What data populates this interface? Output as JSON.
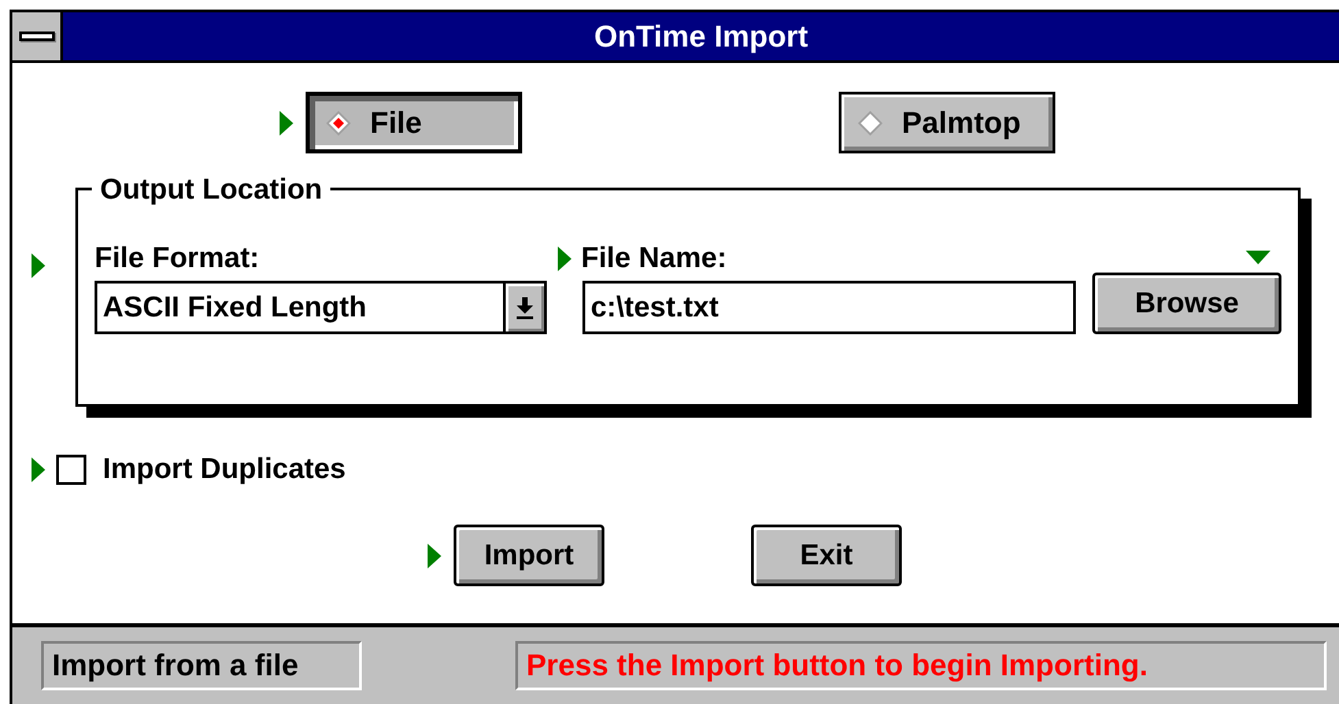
{
  "window": {
    "title": "OnTime Import"
  },
  "source_options": [
    {
      "label": "File",
      "selected": true,
      "marker": true
    },
    {
      "label": "Palmtop",
      "selected": false,
      "marker": false
    }
  ],
  "output_location": {
    "title": "Output Location",
    "marker": true,
    "file_format": {
      "label": "File Format:",
      "value": "ASCII Fixed Length"
    },
    "file_name": {
      "label": "File Name:",
      "value": "c:\\test.txt",
      "marker": true
    },
    "browse": {
      "label": "Browse",
      "marker": true
    }
  },
  "import_duplicates": {
    "label": "Import Duplicates",
    "checked": false,
    "marker": true
  },
  "buttons": [
    {
      "label": "Import",
      "marker": true
    },
    {
      "label": "Exit",
      "marker": false
    }
  ],
  "status_bar": {
    "mode": "Import from a file",
    "message": "Press the Import button to begin Importing."
  }
}
